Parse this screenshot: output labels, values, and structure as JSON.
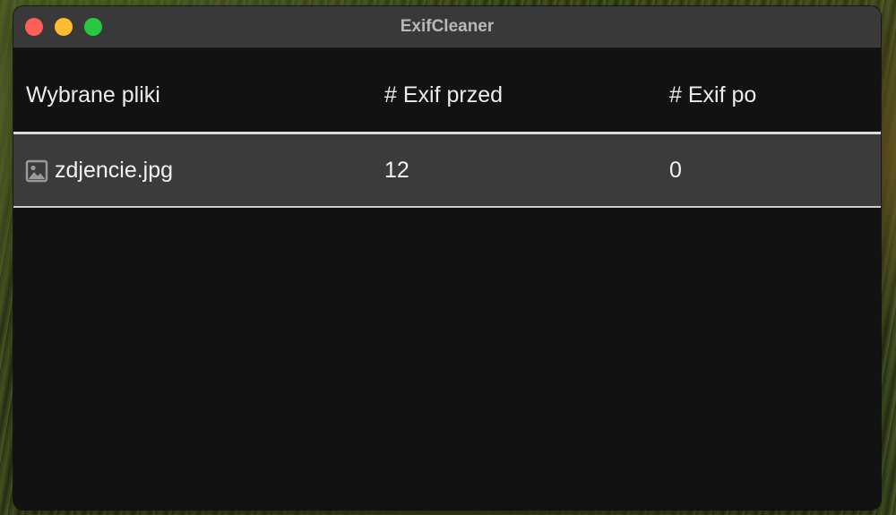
{
  "window": {
    "title": "ExifCleaner"
  },
  "table": {
    "headers": {
      "files": "Wybrane pliki",
      "exif_before": "# Exif przed",
      "exif_after": "# Exif po"
    },
    "rows": [
      {
        "icon": "image-file-icon",
        "filename": "zdjencie.jpg",
        "exif_before": "12",
        "exif_after": "0"
      }
    ]
  },
  "colors": {
    "close": "#fe5f57",
    "minimize": "#febc2e",
    "maximize": "#28c840",
    "row_bg": "#3b3b3b",
    "window_bg": "#121212"
  }
}
